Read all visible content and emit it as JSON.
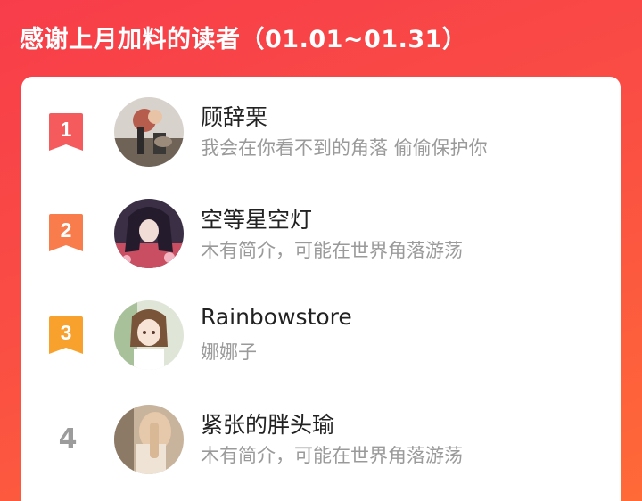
{
  "header": {
    "title": "感谢上月加料的读者（01.01~01.31）"
  },
  "colors": {
    "background_from": "#f73d4a",
    "background_to": "#ff6a37",
    "rank1": "#f55a5c",
    "rank2": "#f97d4c",
    "rank3": "#f8a12c",
    "rank_plain": "#9c9c9c"
  },
  "readers": [
    {
      "rank": "1",
      "name": "顾辞栗",
      "bio": "我会在你看不到的角落 偷偷保护你"
    },
    {
      "rank": "2",
      "name": "空等星空灯",
      "bio": "木有简介，可能在世界角落游荡"
    },
    {
      "rank": "3",
      "name": "Rainbowstore",
      "bio": "娜娜子"
    },
    {
      "rank": "4",
      "name": "紧张的胖头瑜",
      "bio": "木有简介，可能在世界角落游荡"
    }
  ]
}
